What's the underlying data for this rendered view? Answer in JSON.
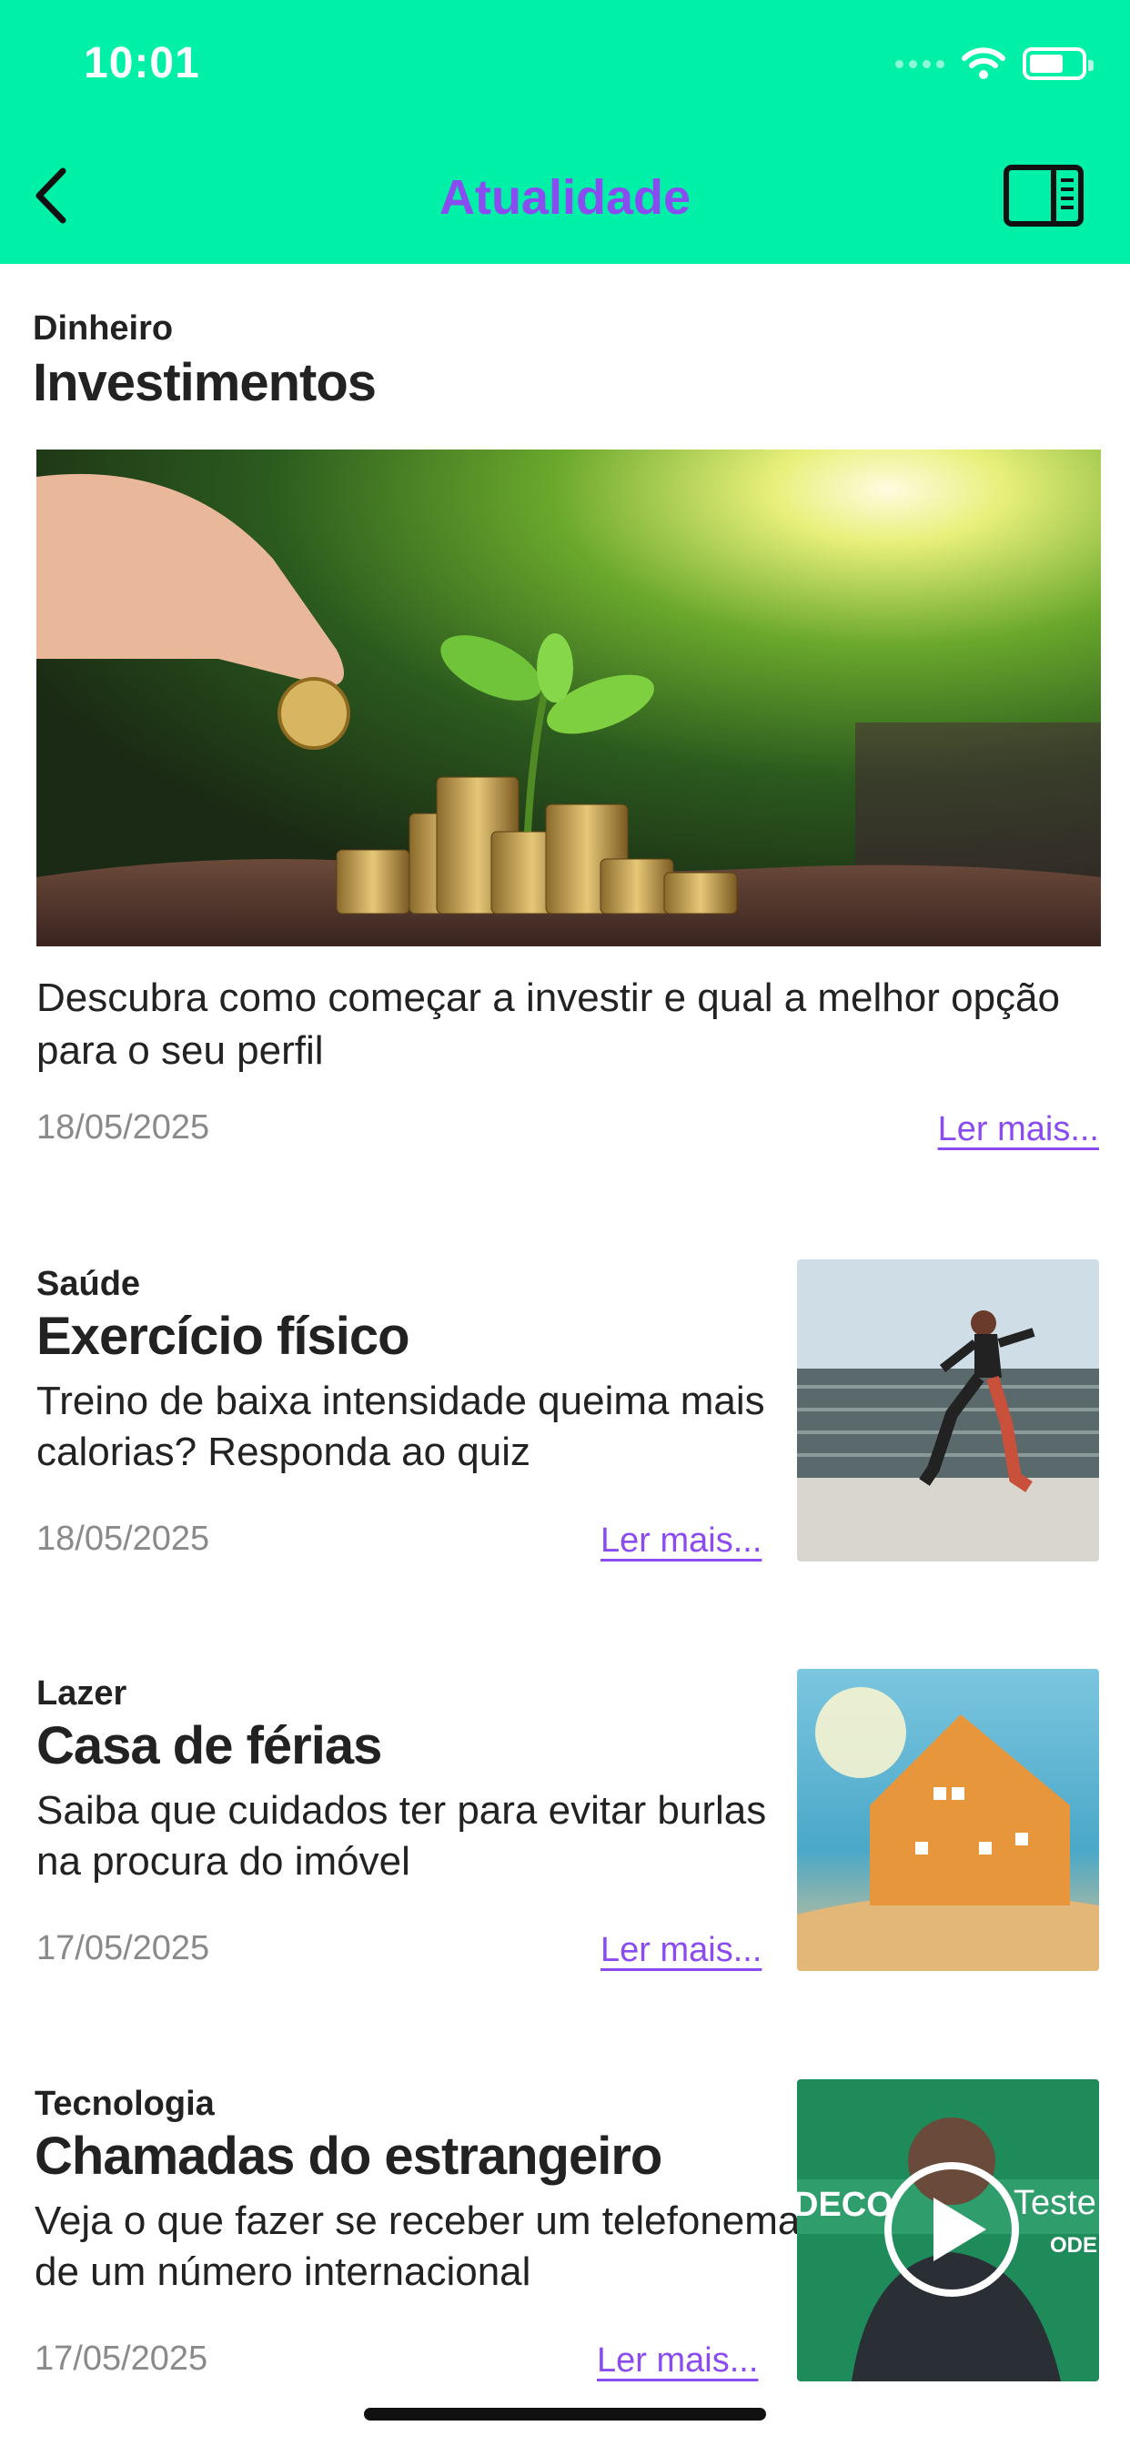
{
  "status_bar": {
    "time": "10:01"
  },
  "nav": {
    "title": "Atualidade"
  },
  "featured": {
    "category": "Dinheiro",
    "title": "Investimentos",
    "summary": "Descubra como começar a investir e qual a melhor opção para o seu perfil",
    "date": "18/05/2025",
    "read_more": "Ler mais..."
  },
  "articles": [
    {
      "category": "Saúde",
      "title": "Exercício físico",
      "summary": "Treino de baixa intensidade queima mais calorias? Responda ao quiz",
      "date": "18/05/2025",
      "read_more": "Ler mais..."
    },
    {
      "category": "Lazer",
      "title": "Casa de férias",
      "summary": "Saiba que cuidados ter para evitar burlas na procura do imóvel",
      "date": "17/05/2025",
      "read_more": "Ler mais..."
    },
    {
      "category": "Tecnologia",
      "title": "Chamadas do estrangeiro",
      "summary": "Veja o que fazer se receber um telefonema de um número internacional",
      "date": "17/05/2025",
      "read_more": "Ler mais...",
      "thumbnail_text": [
        "DECO",
        "Teste",
        "ODE"
      ]
    }
  ],
  "colors": {
    "header_bg": "#00f0a8",
    "accent": "#8a4cf0",
    "date": "#8a8a8a"
  },
  "icons": {
    "back": "chevron-left-icon",
    "panel": "side-panel-icon",
    "wifi": "wifi-icon",
    "battery": "battery-icon",
    "play": "play-icon"
  }
}
